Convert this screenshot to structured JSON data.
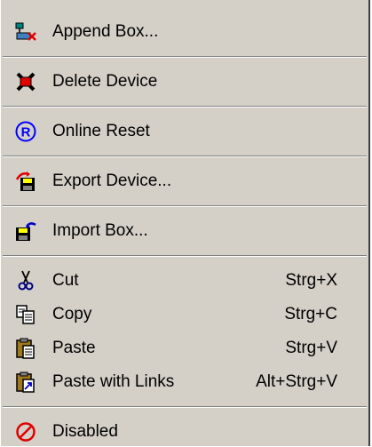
{
  "menu": {
    "items": [
      {
        "label": "Append Box...",
        "icon": "append-box-icon"
      },
      {
        "label": "Delete Device",
        "icon": "delete-device-icon"
      },
      {
        "label": "Online Reset",
        "icon": "online-reset-icon"
      },
      {
        "label": "Export Device...",
        "icon": "export-device-icon"
      },
      {
        "label": "Import Box...",
        "icon": "import-box-icon"
      },
      {
        "label": "Cut",
        "shortcut": "Strg+X",
        "icon": "scissors-icon"
      },
      {
        "label": "Copy",
        "shortcut": "Strg+C",
        "icon": "copy-icon"
      },
      {
        "label": "Paste",
        "shortcut": "Strg+V",
        "icon": "paste-icon"
      },
      {
        "label": "Paste with Links",
        "shortcut": "Alt+Strg+V",
        "icon": "paste-with-links-icon"
      },
      {
        "label": "Disabled",
        "icon": "disabled-icon"
      }
    ]
  },
  "colors": {
    "menu_background": "#d4d0c8",
    "separator_dark": "#808080",
    "delete_red": "#e00000",
    "reset_blue": "#0000ff"
  }
}
